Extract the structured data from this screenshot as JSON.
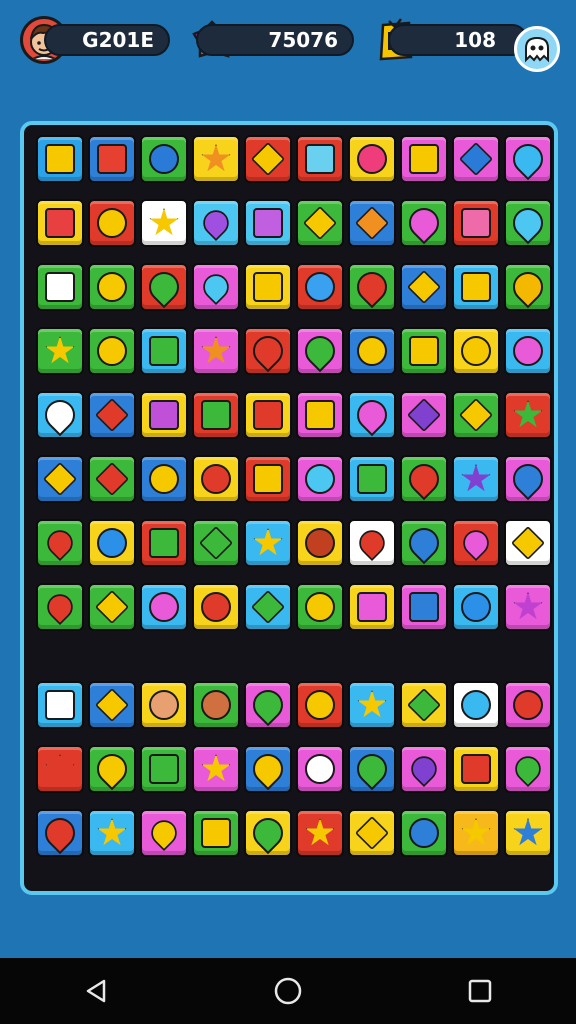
{
  "hud": {
    "player_name": "G201E",
    "coins": "75076",
    "tickets": "108",
    "avatar_icon": "player-avatar",
    "coin_icon": "pink-gem-icon",
    "ticket_icon": "gold-ticket-icon",
    "menu_icon": "ghost-icon"
  },
  "colors": {
    "background": "#1f74b4",
    "board_border": "#5bc8ef",
    "board_fill": "#121218"
  },
  "board": {
    "top_rows": [
      [
        [
          "#2aa3e8",
          "layered-cake",
          "#f5c800",
          "square"
        ],
        [
          "#2d7fd8",
          "ornament",
          "#e64030",
          "square"
        ],
        [
          "#3cb83a",
          "tree",
          "#2a7ad8",
          "circle"
        ],
        [
          "#f7d31c",
          "sun-flower",
          "#f09020",
          "star"
        ],
        [
          "#e03a2a",
          "carrot",
          "#f5c800",
          "diamond"
        ],
        [
          "#e03a2a",
          "phone",
          "#6ad0f0",
          "square"
        ],
        [
          "#f7d31c",
          "face",
          "#ee3d7a",
          "circle"
        ],
        [
          "#e85ad8",
          "window",
          "#f5c800",
          "square"
        ],
        [
          "#e85ad8",
          "pencil",
          "#2a7ad8",
          "diamond"
        ],
        [
          "#e85ad8",
          "leaf",
          "#3ab8f0",
          "drop"
        ]
      ],
      [
        [
          "#f7d31c",
          "sandwich",
          "#e84040",
          "square"
        ],
        [
          "#e03a2a",
          "shell",
          "#f5c800",
          "circle"
        ],
        [
          "#ffffff",
          "flower",
          "#f5c800",
          "star"
        ],
        [
          "#4cc7f2",
          "paw",
          "#a050e0",
          "heart"
        ],
        [
          "#4cc7f2",
          "pot",
          "#c060e0",
          "square"
        ],
        [
          "#3cb83a",
          "book",
          "#f5c800",
          "diamond"
        ],
        [
          "#2d7fd8",
          "key",
          "#f09020",
          "diamond"
        ],
        [
          "#3cb83a",
          "berry",
          "#e85ad8",
          "drop"
        ],
        [
          "#e03a2a",
          "sock",
          "#ee6aa8",
          "square"
        ],
        [
          "#3cb83a",
          "bell",
          "#4cc7f2",
          "drop"
        ]
      ],
      [
        [
          "#3cb83a",
          "cube",
          "#ffffff",
          "square"
        ],
        [
          "#3cb83a",
          "bird",
          "#f5c800",
          "circle"
        ],
        [
          "#e03a2a",
          "leaf",
          "#3cb83a",
          "drop"
        ],
        [
          "#e85ad8",
          "heart",
          "#4cc7f2",
          "heart"
        ],
        [
          "#f7d31c",
          "shield",
          "#f5c800",
          "square"
        ],
        [
          "#e03a2a",
          "mushroom",
          "#3aa0f0",
          "circle"
        ],
        [
          "#3cb83a",
          "balloon",
          "#e03a2a",
          "drop"
        ],
        [
          "#2d7fd8",
          "cheese",
          "#f5c800",
          "diamond"
        ],
        [
          "#3ab8f0",
          "gift",
          "#f5c800",
          "square"
        ],
        [
          "#3cb83a",
          "lemon",
          "#f5b800",
          "drop"
        ]
      ],
      [
        [
          "#3cb83a",
          "sun",
          "#f5c800",
          "star"
        ],
        [
          "#3cb83a",
          "lemon",
          "#f5c800",
          "circle"
        ],
        [
          "#3ab8f0",
          "book",
          "#3cb83a",
          "square"
        ],
        [
          "#e85ad8",
          "flower",
          "#f09020",
          "star"
        ],
        [
          "#e03a2a",
          "strawberry",
          "#e03a2a",
          "drop"
        ],
        [
          "#e85ad8",
          "leaf",
          "#3cb83a",
          "drop"
        ],
        [
          "#2d7fd8",
          "lemon",
          "#f5c800",
          "circle"
        ],
        [
          "#3cb83a",
          "box",
          "#f5c800",
          "square"
        ],
        [
          "#f7d31c",
          "bear",
          "#f5c800",
          "circle"
        ],
        [
          "#3ab8f0",
          "bowl",
          "#e85ad8",
          "circle"
        ]
      ],
      [
        [
          "#3ab8f0",
          "cake",
          "#ffffff",
          "drop"
        ],
        [
          "#2d7fd8",
          "pencil",
          "#e03a2a",
          "diamond"
        ],
        [
          "#f7d31c",
          "cube",
          "#c050d8",
          "square"
        ],
        [
          "#e03a2a",
          "cactus",
          "#3cb83a",
          "square"
        ],
        [
          "#f7d31c",
          "battery",
          "#e03a2a",
          "square"
        ],
        [
          "#e85ad8",
          "chair",
          "#f5c800",
          "square"
        ],
        [
          "#3ab8f0",
          "balloon",
          "#e85ad8",
          "drop"
        ],
        [
          "#e85ad8",
          "marker",
          "#8040d0",
          "diamond"
        ],
        [
          "#3cb83a",
          "pencil",
          "#f5c800",
          "diamond"
        ],
        [
          "#e03a2a",
          "sprout",
          "#3cb83a",
          "star"
        ]
      ],
      [
        [
          "#2d7fd8",
          "brush",
          "#f5c800",
          "diamond"
        ],
        [
          "#3cb83a",
          "kite",
          "#e03a2a",
          "diamond"
        ],
        [
          "#2d7fd8",
          "spoon",
          "#f5c800",
          "circle"
        ],
        [
          "#f7d31c",
          "egg",
          "#e03a2a",
          "circle"
        ],
        [
          "#e03a2a",
          "trophy",
          "#f5c800",
          "square"
        ],
        [
          "#e85ad8",
          "face",
          "#4cc7f2",
          "circle"
        ],
        [
          "#3ab8f0",
          "jar",
          "#3cb83a",
          "square"
        ],
        [
          "#3cb83a",
          "strawberry",
          "#e03a2a",
          "drop"
        ],
        [
          "#3ab8f0",
          "flower",
          "#8040d0",
          "star"
        ],
        [
          "#e85ad8",
          "plum",
          "#2d7fd8",
          "drop"
        ]
      ],
      [
        [
          "#3cb83a",
          "rose",
          "#e03a2a",
          "heart"
        ],
        [
          "#f7d31c",
          "ball",
          "#2a90e8",
          "circle"
        ],
        [
          "#e03a2a",
          "box",
          "#3cb83a",
          "square"
        ],
        [
          "#3cb83a",
          "battery",
          "#3cb83a",
          "diamond"
        ],
        [
          "#3ab8f0",
          "star",
          "#f5c800",
          "star"
        ],
        [
          "#f7d31c",
          "person",
          "#c04020",
          "circle"
        ],
        [
          "#ffffff",
          "heart",
          "#e03a2a",
          "heart"
        ],
        [
          "#3cb83a",
          "bottle",
          "#2d7fd8",
          "drop"
        ],
        [
          "#e03a2a",
          "heart",
          "#e85ad8",
          "heart"
        ],
        [
          "#ffffff",
          "hat",
          "#f5c800",
          "diamond"
        ]
      ],
      [
        [
          "#3cb83a",
          "heart",
          "#e03a2a",
          "heart"
        ],
        [
          "#3cb83a",
          "cone",
          "#f5c800",
          "diamond"
        ],
        [
          "#3ab8f0",
          "shell",
          "#e85ad8",
          "circle"
        ],
        [
          "#f7d31c",
          "apple",
          "#e03a2a",
          "circle"
        ],
        [
          "#3ab8f0",
          "ruler",
          "#3cb83a",
          "diamond"
        ],
        [
          "#3cb83a",
          "tree",
          "#f5c800",
          "circle"
        ],
        [
          "#f7d31c",
          "cupcake",
          "#e85ad8",
          "square"
        ],
        [
          "#e85ad8",
          "book",
          "#2d7fd8",
          "square"
        ],
        [
          "#3ab8f0",
          "spiral",
          "#2a90e8",
          "circle"
        ],
        [
          "#e85ad8",
          "star",
          "#c040d0",
          "star"
        ]
      ]
    ],
    "bottom_rows": [
      [
        [
          "#3ab8f0",
          "cake",
          "#ffffff",
          "square"
        ],
        [
          "#2d7fd8",
          "cookie",
          "#f5c800",
          "diamond"
        ],
        [
          "#f7d31c",
          "boy",
          "#e8a070",
          "circle"
        ],
        [
          "#3cb83a",
          "girl",
          "#d07040",
          "circle"
        ],
        [
          "#e85ad8",
          "leaf",
          "#3cb83a",
          "drop"
        ],
        [
          "#e03a2a",
          "snail",
          "#f5c800",
          "circle"
        ],
        [
          "#3ab8f0",
          "bird",
          "#f5c800",
          "star"
        ],
        [
          "#f7d31c",
          "crayon",
          "#3cb83a",
          "diamond"
        ],
        [
          "#ffffff",
          "spiral",
          "#3ab8f0",
          "circle"
        ],
        [
          "#e85ad8",
          "button",
          "#e03a2a",
          "circle"
        ]
      ],
      [
        [
          "#e03a2a",
          "flower",
          "#e03a2a",
          "star"
        ],
        [
          "#3cb83a",
          "lemon",
          "#f5c800",
          "drop"
        ],
        [
          "#3cb83a",
          "book",
          "#3cb83a",
          "square"
        ],
        [
          "#e85ad8",
          "sun",
          "#f5c800",
          "star"
        ],
        [
          "#2d7fd8",
          "bell",
          "#f5c800",
          "drop"
        ],
        [
          "#e85ad8",
          "egg",
          "#ffffff",
          "circle"
        ],
        [
          "#2d7fd8",
          "leaf",
          "#3cb83a",
          "drop"
        ],
        [
          "#e85ad8",
          "apple",
          "#8040d0",
          "heart"
        ],
        [
          "#f7d31c",
          "battery",
          "#e03a2a",
          "square"
        ],
        [
          "#e85ad8",
          "apple",
          "#3cb83a",
          "heart"
        ]
      ],
      [
        [
          "#2d7fd8",
          "drop",
          "#e03a2a",
          "drop"
        ],
        [
          "#3ab8f0",
          "star",
          "#f5c800",
          "star"
        ],
        [
          "#e85ad8",
          "apple",
          "#f5c800",
          "heart"
        ],
        [
          "#3cb83a",
          "crown",
          "#f5c800",
          "square"
        ],
        [
          "#f7d31c",
          "lemon",
          "#3cb83a",
          "drop"
        ],
        [
          "#e03a2a",
          "star",
          "#f5c800",
          "star"
        ],
        [
          "#f7d31c",
          "pencil",
          "#f5c800",
          "diamond"
        ],
        [
          "#3cb83a",
          "ring",
          "#2d7fd8",
          "circle"
        ],
        [
          "#f7b81c",
          "star",
          "#f5c800",
          "star"
        ],
        [
          "#f7d31c",
          "gear",
          "#2d7fd8",
          "star"
        ]
      ]
    ]
  }
}
